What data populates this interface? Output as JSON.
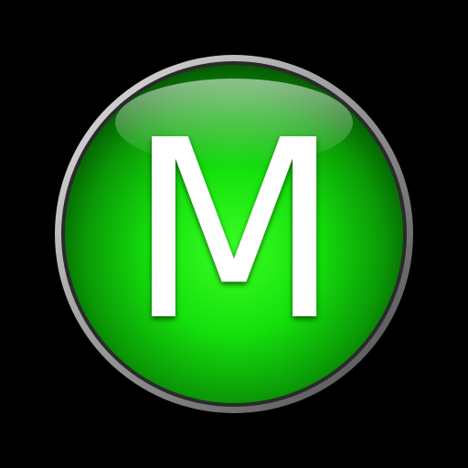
{
  "icon": {
    "name": "m-badge-icon",
    "letter": "M",
    "colors": {
      "background": "#000000",
      "ring_light": "#d8d8d8",
      "ring_dark": "#5a5a5a",
      "green_center": "#2cff1a",
      "green_mid": "#12d80a",
      "green_edge": "#066c04",
      "letter_fill": "#ffffff",
      "letter_shadow": "#0b3a06"
    }
  }
}
